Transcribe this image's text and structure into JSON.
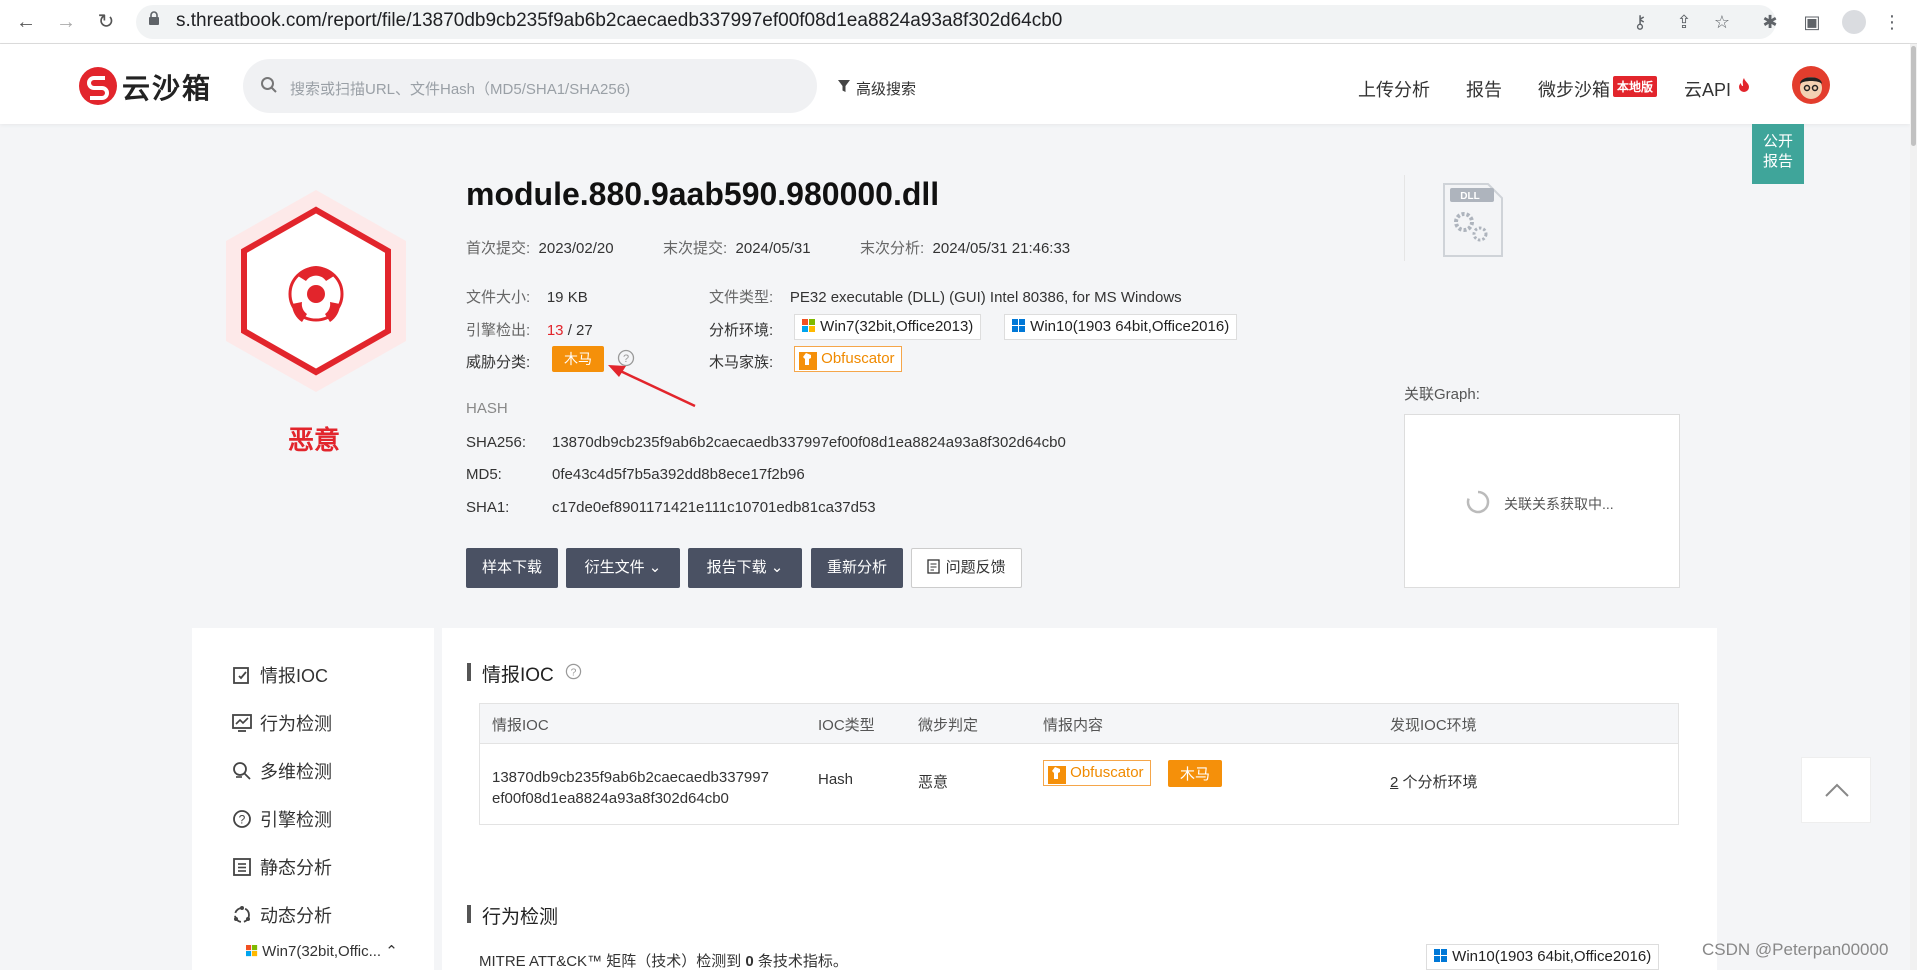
{
  "browser": {
    "url": "s.threatbook.com/report/file/13870db9cb235f9ab6b2caecaedb337997ef00f08d1ea8824a93a8f302d64cb0"
  },
  "header": {
    "logo_text": "云沙箱",
    "search_placeholder": "搜索或扫描URL、文件Hash（MD5/SHA1/SHA256)",
    "advanced_search": "高级搜索",
    "nav": [
      "上传分析",
      "报告",
      "微步沙箱",
      "云API"
    ],
    "local_badge": "本地版",
    "public_report": [
      "公开",
      "报告"
    ]
  },
  "summary": {
    "filename": "module.880.9aab590.980000.dll",
    "verdict": "恶意",
    "file_icon_label": "DLL",
    "first_submit_label": "首次提交:",
    "first_submit": "2023/02/20",
    "last_submit_label": "末次提交:",
    "last_submit": "2024/05/31",
    "last_analysis_label": "末次分析:",
    "last_analysis": "2024/05/31 21:46:33",
    "size_label": "文件大小:",
    "size": "19 KB",
    "engine_label": "引擎检出:",
    "engine_hits": "13",
    "engine_total": "/ 27",
    "threat_label": "威胁分类:",
    "threat": "木马",
    "filetype_label": "文件类型:",
    "filetype": "PE32 executable (DLL) (GUI) Intel 80386, for MS Windows",
    "env_label": "分析环境:",
    "envs": [
      "Win7(32bit,Office2013)",
      "Win10(1903 64bit,Office2016)"
    ],
    "family_label": "木马家族:",
    "family": "Obfuscator"
  },
  "hash": {
    "title": "HASH",
    "sha256_label": "SHA256:",
    "sha256": "13870db9cb235f9ab6b2caecaedb337997ef00f08d1ea8824a93a8f302d64cb0",
    "md5_label": "MD5:",
    "md5": "0fe43c4d5f7b5a392dd8b8ece17f2b96",
    "sha1_label": "SHA1:",
    "sha1": "c17de0ef8901171421e111c10701edb81ca37d53"
  },
  "actions": {
    "sample_download": "样本下载",
    "derived_files": "衍生文件",
    "report_download": "报告下载",
    "reanalyze": "重新分析",
    "feedback": "问题反馈"
  },
  "graph": {
    "label": "关联Graph:",
    "loading": "关联关系获取中..."
  },
  "sidebar": {
    "items": [
      "情报IOC",
      "行为检测",
      "多维检测",
      "引擎检测",
      "静态分析",
      "动态分析"
    ],
    "sub_item": "Win7(32bit,Offic..."
  },
  "ioc": {
    "title": "情报IOC",
    "columns": [
      "情报IOC",
      "IOC类型",
      "微步判定",
      "情报内容",
      "发现IOC环境"
    ],
    "row": {
      "ioc_line1": "13870db9cb235f9ab6b2caecaedb337997",
      "ioc_line2": "ef00f08d1ea8824a93a8f302d64cb0",
      "type": "Hash",
      "verdict": "恶意",
      "family": "Obfuscator",
      "threat": "木马",
      "env_count": "2",
      "env_text": "个分析环境"
    }
  },
  "behavior": {
    "title": "行为检测",
    "text_prefix": "MITRE ATT&CK™ 矩阵（技术）检测到",
    "count": "0",
    "text_suffix": "条技术指标。",
    "env_tab": "Win10(1903 64bit,Office2016)"
  },
  "watermark": "CSDN @Peterpan00000",
  "colors": {
    "malicious_red": "#e2252c",
    "trojan_orange": "#f5900a",
    "button_dark": "#4a5163",
    "public_teal": "#3fa59a"
  }
}
